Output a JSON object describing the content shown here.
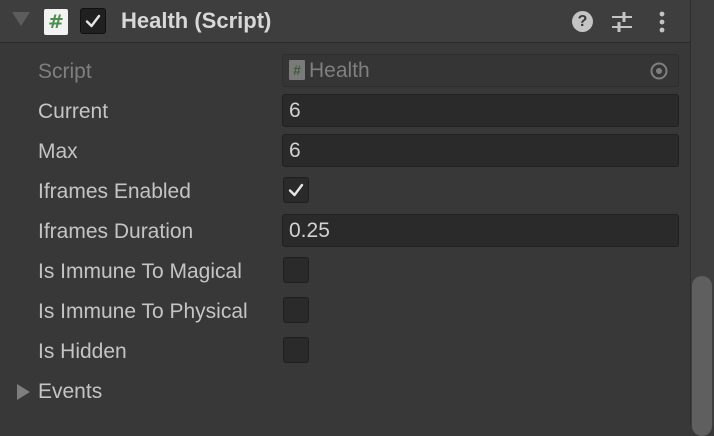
{
  "component": {
    "title": "Health (Script)",
    "enabled": true,
    "script_icon": "#"
  },
  "header_icons": {
    "help": "?",
    "fold": "foldout-triangle-icon",
    "preset": "preset-sliders-icon",
    "menu": "kebab-menu-icon"
  },
  "fields": {
    "script": {
      "label": "Script",
      "value": "Health",
      "icon": "#"
    },
    "current": {
      "label": "Current",
      "value": "6"
    },
    "max": {
      "label": "Max",
      "value": "6"
    },
    "iframes_enabled": {
      "label": "Iframes Enabled",
      "checked": true
    },
    "iframes_duration": {
      "label": "Iframes Duration",
      "value": "0.25"
    },
    "is_immune_magical": {
      "label": "Is Immune To Magical",
      "checked": false
    },
    "is_immune_physical": {
      "label": "Is Immune To Physical",
      "checked": false
    },
    "is_hidden": {
      "label": "Is Hidden",
      "checked": false
    }
  },
  "events": {
    "label": "Events"
  },
  "colors": {
    "panel_bg": "#383838",
    "header_bg": "#3e3e3e",
    "field_bg": "#2a2a2a",
    "text": "#c4c4c4",
    "dim_text": "#7f7f7f",
    "script_green": "#4c8e4c"
  }
}
